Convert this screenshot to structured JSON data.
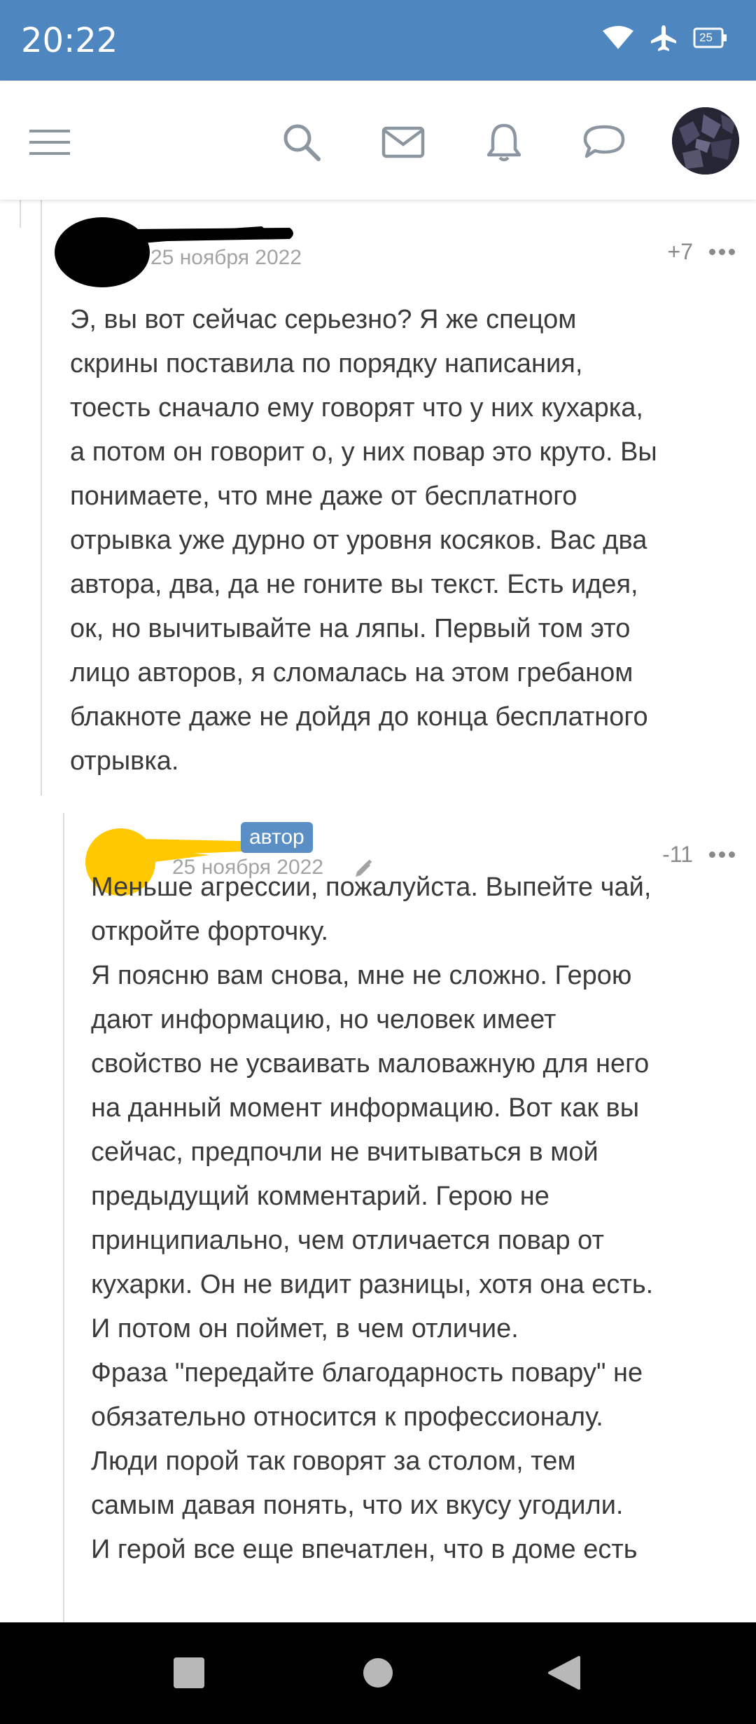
{
  "status_bar": {
    "time": "20:22",
    "battery": "25",
    "icons": [
      "wifi-icon",
      "airplane-mode-icon",
      "battery-icon"
    ]
  },
  "header": {
    "icons": [
      "menu-icon",
      "search-icon",
      "mail-icon",
      "bell-icon",
      "chat-icon"
    ]
  },
  "comments": [
    {
      "date": "25 ноября 2022",
      "score": "+7",
      "text": "Э, вы вот сейчас серьезно? Я же спецом\nскрины поставила по порядку написания,\nтоесть сначало ему говорят что у них кухарка,\nа потом он говорит о, у них повар это круто. Вы\nпонимаете, что мне даже от бесплатного\nотрывка уже дурно от уровня косяков. Вас два\nавтора, два, да не гоните вы текст. Есть идея,\nок, но вычитывайте на ляпы. Первый том это\nлицо авторов, я сломалась на этом гребаном\nблакноте даже не дойдя до конца бесплатного\nотрывка."
    },
    {
      "badge": "автор",
      "date": "25 ноября 2022",
      "score": "-11",
      "text": "Меньше агрессии, пожалуйста. Выпейте чай,\nоткройте форточку.\nЯ поясню вам снова, мне не сложно. Герою\nдают информацию, но человек имеет\nсвойство не усваивать маловажную для него\nна данный момент информацию. Вот как вы\nсейчас, предпочли не вчитываться в мой\nпредыдущий комментарий. Герою не\nпринципиально, чем отличается повар от\nкухарки. Он не видит разницы, хотя она есть.\nИ потом он поймет, в чем отличие.\nФраза \"передайте благодарность повару\" не\nобязательно относится к профессионалу.\nЛюди порой так говорят за столом, тем\nсамым давая понять, что их вкусу угодили.\nИ герой все еще впечатлен, что в доме есть"
    }
  ],
  "colors": {
    "status_bar": "#4e86c0",
    "badge": "#5a8fc6",
    "author1_scribble": "#000000",
    "author2_scribble": "#ffc800"
  },
  "nav_bar": {
    "icons": [
      "recents-icon",
      "home-icon",
      "back-icon"
    ]
  }
}
